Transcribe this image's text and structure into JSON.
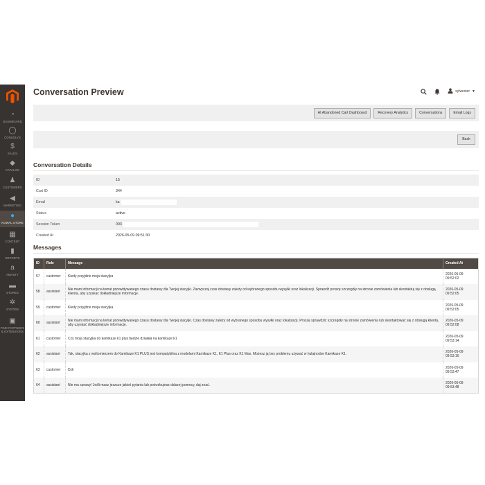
{
  "sidebar": {
    "items": [
      {
        "label": "DASHBOARD",
        "icon": "speedometer-icon"
      },
      {
        "label": "CONSOLYS",
        "icon": "circle-icon"
      },
      {
        "label": "SALES",
        "icon": "dollar-icon"
      },
      {
        "label": "CATALOG",
        "icon": "box-icon"
      },
      {
        "label": "CUSTOMERS",
        "icon": "person-icon"
      },
      {
        "label": "MARKETING",
        "icon": "megaphone-icon"
      },
      {
        "label": "KOWAL.STORE",
        "icon": "globe-icon",
        "active": true
      },
      {
        "label": "CONTENT",
        "icon": "layout-icon"
      },
      {
        "label": "REPORTS",
        "icon": "bar-chart-icon"
      },
      {
        "label": "AMASTY",
        "icon": "amasty-icon"
      },
      {
        "label": "STORES",
        "icon": "storefront-icon"
      },
      {
        "label": "SYSTEM",
        "icon": "gear-icon"
      },
      {
        "label": "FIND PARTNERS & EXTENSIONS",
        "icon": "puzzle-icon"
      }
    ]
  },
  "header": {
    "title": "Conversation Preview",
    "user": "sylwester"
  },
  "toolbar": {
    "buttons": [
      "AI Abandoned Cart Dashboard",
      "Recovery Analytics",
      "Conversations",
      "Email Logs"
    ],
    "back": "Back"
  },
  "details": {
    "title": "Conversation Details",
    "rows": [
      {
        "label": "ID",
        "value": "15"
      },
      {
        "label": "Cart ID",
        "value": "344"
      },
      {
        "label": "Email",
        "value": "ka"
      },
      {
        "label": "Status",
        "value": "active"
      },
      {
        "label": "Session Token",
        "value": "003"
      },
      {
        "label": "Created At",
        "value": "2026-05-09 09:51:30"
      }
    ]
  },
  "messages": {
    "title": "Messages",
    "columns": [
      "ID",
      "Role",
      "Message",
      "Created At"
    ],
    "rows": [
      {
        "id": "57",
        "role": "customer",
        "message": "Kiedy przyjdzie moja stacyjka",
        "created_date": "2026-05-09",
        "created_time": "09:52:02"
      },
      {
        "id": "58",
        "role": "assistant",
        "message": "Nie mam informacji na temat przewidywanego czasu dostawy dla Twojej stacyjki. Zazwyczaj czas dostawy zależy od wybranego sposobu wysyłki oraz lokalizacji. Sprawdź proszę szczegóły na stronie zamówienia lub skontaktuj się z obsługą klienta, aby uzyskać dokładniejsze informacje.",
        "created_date": "2026-05-09",
        "created_time": "09:52:05"
      },
      {
        "id": "59",
        "role": "customer",
        "message": "Kiedy przyjdzie moja stacyjka",
        "created_date": "2026-05-09",
        "created_time": "09:52:05"
      },
      {
        "id": "60",
        "role": "assistant",
        "message": "Nie mam informacji na temat przewidywanego czasu dostawy dla Twojej stacyjki. Czas dostawy zależy od wybranego sposobu wysyłki oraz lokalizacji. Proszę sprawdzić szczegóły na stronie zamówienia lub skontaktować się z obsługą klienta, aby uzyskać dokładniejsze informacje.",
        "created_date": "2026-05-09",
        "created_time": "09:52:08"
      },
      {
        "id": "61",
        "role": "customer",
        "message": "Czy moja stacyjka do kamikaze k1 plus będzie działała na kamikaze k1",
        "created_date": "2026-05-09",
        "created_time": "09:53:14"
      },
      {
        "id": "62",
        "role": "assistant",
        "message": "Tak, stacyjka z woltomierzem do Kamikaze K1 PLUS jest kompatybilna z modelami Kamikaze K1, K1 Plus oraz K1 Max. Możesz ją bez problemu używać w hulajnodze Kamikaze K1.",
        "created_date": "2026-05-09",
        "created_time": "09:53:16"
      },
      {
        "id": "63",
        "role": "customer",
        "message": "Dzk",
        "created_date": "2026-05-09",
        "created_time": "09:53:47"
      },
      {
        "id": "64",
        "role": "assistant",
        "message": "Nie ma sprawy! Jeśli masz jeszcze jakieś pytania lub potrzebujesz dalszej pomocy, daj znać.",
        "created_date": "2026-05-09",
        "created_time": "09:53:48"
      }
    ]
  },
  "colors": {
    "sidebar_bg": "#373330",
    "logo_orange": "#eb5202",
    "table_header_bg": "#514943",
    "active_icon": "#36a4f4"
  }
}
